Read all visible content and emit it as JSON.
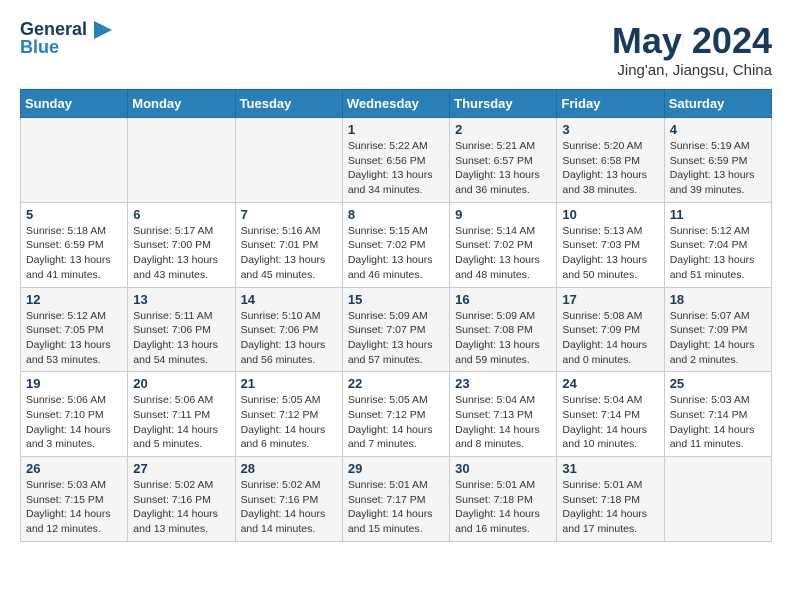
{
  "header": {
    "logo_general": "General",
    "logo_blue": "Blue",
    "month_year": "May 2024",
    "location": "Jing'an, Jiangsu, China"
  },
  "weekdays": [
    "Sunday",
    "Monday",
    "Tuesday",
    "Wednesday",
    "Thursday",
    "Friday",
    "Saturday"
  ],
  "weeks": [
    [
      {
        "day": "",
        "info": ""
      },
      {
        "day": "",
        "info": ""
      },
      {
        "day": "",
        "info": ""
      },
      {
        "day": "1",
        "info": "Sunrise: 5:22 AM\nSunset: 6:56 PM\nDaylight: 13 hours\nand 34 minutes."
      },
      {
        "day": "2",
        "info": "Sunrise: 5:21 AM\nSunset: 6:57 PM\nDaylight: 13 hours\nand 36 minutes."
      },
      {
        "day": "3",
        "info": "Sunrise: 5:20 AM\nSunset: 6:58 PM\nDaylight: 13 hours\nand 38 minutes."
      },
      {
        "day": "4",
        "info": "Sunrise: 5:19 AM\nSunset: 6:59 PM\nDaylight: 13 hours\nand 39 minutes."
      }
    ],
    [
      {
        "day": "5",
        "info": "Sunrise: 5:18 AM\nSunset: 6:59 PM\nDaylight: 13 hours\nand 41 minutes."
      },
      {
        "day": "6",
        "info": "Sunrise: 5:17 AM\nSunset: 7:00 PM\nDaylight: 13 hours\nand 43 minutes."
      },
      {
        "day": "7",
        "info": "Sunrise: 5:16 AM\nSunset: 7:01 PM\nDaylight: 13 hours\nand 45 minutes."
      },
      {
        "day": "8",
        "info": "Sunrise: 5:15 AM\nSunset: 7:02 PM\nDaylight: 13 hours\nand 46 minutes."
      },
      {
        "day": "9",
        "info": "Sunrise: 5:14 AM\nSunset: 7:02 PM\nDaylight: 13 hours\nand 48 minutes."
      },
      {
        "day": "10",
        "info": "Sunrise: 5:13 AM\nSunset: 7:03 PM\nDaylight: 13 hours\nand 50 minutes."
      },
      {
        "day": "11",
        "info": "Sunrise: 5:12 AM\nSunset: 7:04 PM\nDaylight: 13 hours\nand 51 minutes."
      }
    ],
    [
      {
        "day": "12",
        "info": "Sunrise: 5:12 AM\nSunset: 7:05 PM\nDaylight: 13 hours\nand 53 minutes."
      },
      {
        "day": "13",
        "info": "Sunrise: 5:11 AM\nSunset: 7:06 PM\nDaylight: 13 hours\nand 54 minutes."
      },
      {
        "day": "14",
        "info": "Sunrise: 5:10 AM\nSunset: 7:06 PM\nDaylight: 13 hours\nand 56 minutes."
      },
      {
        "day": "15",
        "info": "Sunrise: 5:09 AM\nSunset: 7:07 PM\nDaylight: 13 hours\nand 57 minutes."
      },
      {
        "day": "16",
        "info": "Sunrise: 5:09 AM\nSunset: 7:08 PM\nDaylight: 13 hours\nand 59 minutes."
      },
      {
        "day": "17",
        "info": "Sunrise: 5:08 AM\nSunset: 7:09 PM\nDaylight: 14 hours\nand 0 minutes."
      },
      {
        "day": "18",
        "info": "Sunrise: 5:07 AM\nSunset: 7:09 PM\nDaylight: 14 hours\nand 2 minutes."
      }
    ],
    [
      {
        "day": "19",
        "info": "Sunrise: 5:06 AM\nSunset: 7:10 PM\nDaylight: 14 hours\nand 3 minutes."
      },
      {
        "day": "20",
        "info": "Sunrise: 5:06 AM\nSunset: 7:11 PM\nDaylight: 14 hours\nand 5 minutes."
      },
      {
        "day": "21",
        "info": "Sunrise: 5:05 AM\nSunset: 7:12 PM\nDaylight: 14 hours\nand 6 minutes."
      },
      {
        "day": "22",
        "info": "Sunrise: 5:05 AM\nSunset: 7:12 PM\nDaylight: 14 hours\nand 7 minutes."
      },
      {
        "day": "23",
        "info": "Sunrise: 5:04 AM\nSunset: 7:13 PM\nDaylight: 14 hours\nand 8 minutes."
      },
      {
        "day": "24",
        "info": "Sunrise: 5:04 AM\nSunset: 7:14 PM\nDaylight: 14 hours\nand 10 minutes."
      },
      {
        "day": "25",
        "info": "Sunrise: 5:03 AM\nSunset: 7:14 PM\nDaylight: 14 hours\nand 11 minutes."
      }
    ],
    [
      {
        "day": "26",
        "info": "Sunrise: 5:03 AM\nSunset: 7:15 PM\nDaylight: 14 hours\nand 12 minutes."
      },
      {
        "day": "27",
        "info": "Sunrise: 5:02 AM\nSunset: 7:16 PM\nDaylight: 14 hours\nand 13 minutes."
      },
      {
        "day": "28",
        "info": "Sunrise: 5:02 AM\nSunset: 7:16 PM\nDaylight: 14 hours\nand 14 minutes."
      },
      {
        "day": "29",
        "info": "Sunrise: 5:01 AM\nSunset: 7:17 PM\nDaylight: 14 hours\nand 15 minutes."
      },
      {
        "day": "30",
        "info": "Sunrise: 5:01 AM\nSunset: 7:18 PM\nDaylight: 14 hours\nand 16 minutes."
      },
      {
        "day": "31",
        "info": "Sunrise: 5:01 AM\nSunset: 7:18 PM\nDaylight: 14 hours\nand 17 minutes."
      },
      {
        "day": "",
        "info": ""
      }
    ]
  ]
}
